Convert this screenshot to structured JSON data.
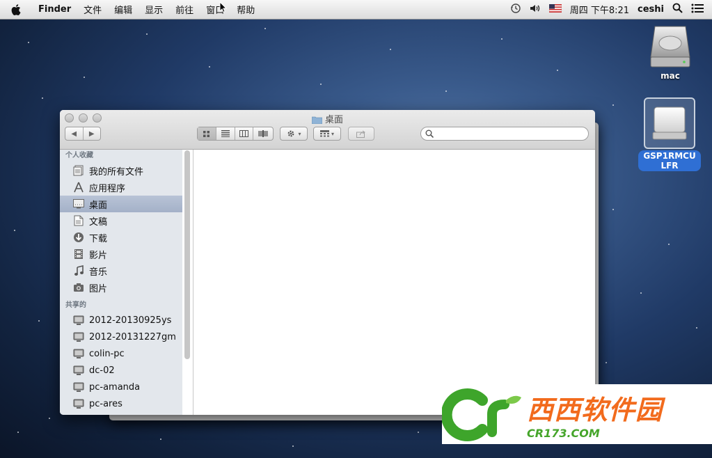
{
  "menubar": {
    "app_name": "Finder",
    "items": [
      "文件",
      "编辑",
      "显示",
      "前往",
      "窗口",
      "帮助"
    ],
    "clock": "周四 下午8:21",
    "user": "ceshi"
  },
  "desktop": {
    "icons": [
      {
        "label": "mac"
      },
      {
        "label": "GSP1RMCULFR"
      }
    ]
  },
  "window": {
    "title": "桌面",
    "search_placeholder": "",
    "sidebar": {
      "favorites_header": "个人收藏",
      "favorites": [
        {
          "label": "我的所有文件",
          "icon": "all-files-icon"
        },
        {
          "label": "应用程序",
          "icon": "applications-icon"
        },
        {
          "label": "桌面",
          "icon": "desktop-icon",
          "selected": true
        },
        {
          "label": "文稿",
          "icon": "documents-icon"
        },
        {
          "label": "下载",
          "icon": "downloads-icon"
        },
        {
          "label": "影片",
          "icon": "movies-icon"
        },
        {
          "label": "音乐",
          "icon": "music-icon"
        },
        {
          "label": "图片",
          "icon": "pictures-icon"
        }
      ],
      "shared_header": "共享的",
      "shared": [
        {
          "label": "2012-20130925ys"
        },
        {
          "label": "2012-20131227gm"
        },
        {
          "label": "colin-pc"
        },
        {
          "label": "dc-02"
        },
        {
          "label": "pc-amanda"
        },
        {
          "label": "pc-ares"
        }
      ]
    }
  },
  "watermark": {
    "brand": "西西软件园",
    "domain": "CR173.COM"
  },
  "colors": {
    "selection": "#a4b1c8",
    "sidebar_bg": "#e3e7ec",
    "watermark_orange": "#f26b1d",
    "watermark_green": "#45a52a"
  }
}
